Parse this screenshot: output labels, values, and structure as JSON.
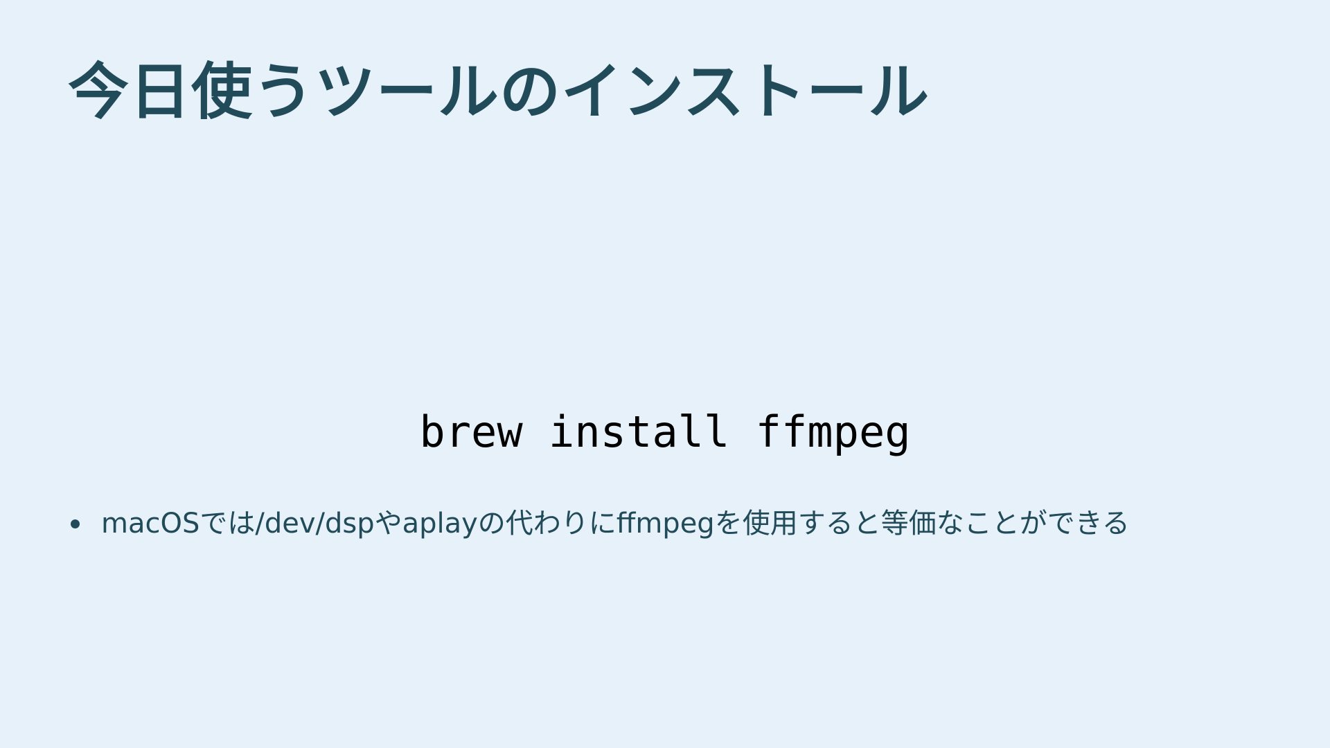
{
  "slide": {
    "title": "今日使うツールのインストール",
    "command": "brew install ffmpeg",
    "bullets": [
      "macOSでは/dev/dspやaplayの代わりにffmpegを使用すると等価なことができる"
    ]
  },
  "colors": {
    "background": "#e7f1f9",
    "title": "#224b5a",
    "code": "#000000",
    "body_text": "#224b5a"
  }
}
